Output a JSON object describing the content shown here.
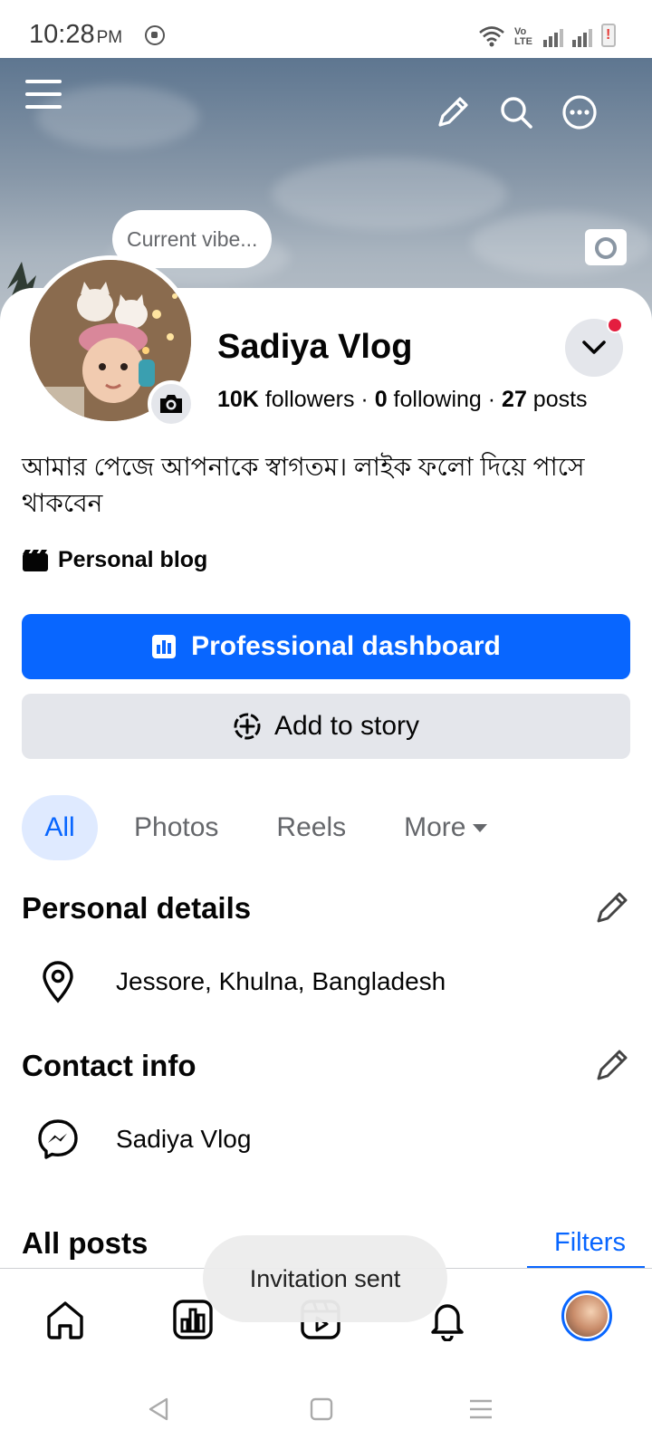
{
  "status": {
    "time": "10:28",
    "ampm": "PM",
    "network": "Vo LTE"
  },
  "cover": {
    "vibe_placeholder": "Current vibe..."
  },
  "profile": {
    "name": "Sadiya Vlog",
    "followers_count": "10K",
    "followers_label": " followers · ",
    "following_count": "0",
    "following_label": " following · ",
    "posts_count": "27",
    "posts_label": " posts",
    "bio": "আমার পেজে আপনাকে স্বাগতম। লাইক ফলো দিয়ে পাসে থাকবেন",
    "category": "Personal blog"
  },
  "actions": {
    "dashboard_label": "Professional dashboard",
    "story_label": "Add to story"
  },
  "tabs": [
    {
      "label": "All",
      "active": true
    },
    {
      "label": "Photos",
      "active": false
    },
    {
      "label": "Reels",
      "active": false
    },
    {
      "label": "More",
      "active": false
    }
  ],
  "personal_details": {
    "title": "Personal details",
    "location": "Jessore, Khulna, Bangladesh"
  },
  "contact_info": {
    "title": "Contact info",
    "messenger": "Sadiya Vlog"
  },
  "posts": {
    "title": "All posts",
    "filters_label": "Filters"
  },
  "toast": {
    "message": "Invitation sent"
  },
  "nav": {
    "items": [
      "home-icon",
      "dashboard-icon",
      "video-icon",
      "bell-icon",
      "profile-avatar"
    ]
  },
  "colors": {
    "accent": "#0866ff",
    "notification_dot": "#e41e3f"
  }
}
